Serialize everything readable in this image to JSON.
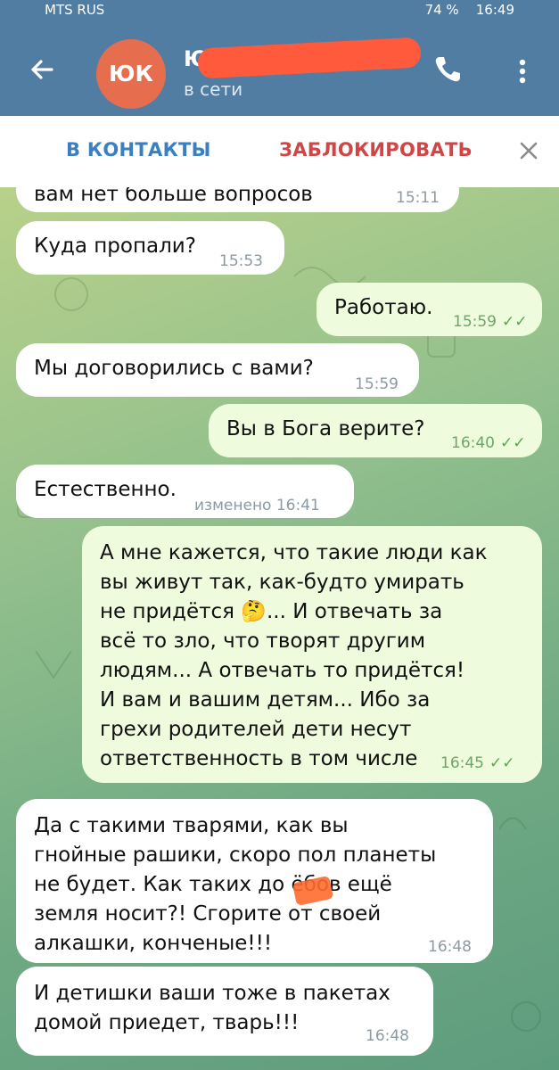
{
  "status_bar": {
    "carrier": "MTS RUS",
    "battery": "74 %",
    "clock": "16:49"
  },
  "header": {
    "avatar_initials": "ЮК",
    "contact_name": "Ю",
    "contact_status": "в сети",
    "colors": {
      "bar": "#517da2",
      "avatar": "#e66d4e"
    }
  },
  "actions": {
    "add_contact": "В КОНТАКТЫ",
    "block": "ЗАБЛОКИРОВАТЬ"
  },
  "messages": [
    {
      "dir": "in",
      "text": "вам нет больше вопросов",
      "time": "15:11"
    },
    {
      "dir": "in",
      "text": "Куда пропали?",
      "time": "15:53"
    },
    {
      "dir": "out",
      "text": "Работаю.",
      "time": "15:59"
    },
    {
      "dir": "in",
      "text": "Мы договорились с вами?",
      "time": "15:59"
    },
    {
      "dir": "out",
      "text": "Вы в Бога верите?",
      "time": "16:40"
    },
    {
      "dir": "in",
      "text": "Естественно.",
      "time": "изменено 16:41"
    },
    {
      "dir": "out",
      "text": "А мне кажется, что такие люди как\nвы живут так, как-будто умирать\nне придётся 🤔... И отвечать за\nвсё то зло, что творят другим\nлюдям... А отвечать то придётся!\nИ вам и вашим детям... Ибо за\nгрехи родителей дети несут\nответственность в том числе",
      "time": "16:45"
    },
    {
      "dir": "in",
      "text": "Да с такими тварями, как вы\nгнойные рашики, скоро пол планеты\nне будет. Как таких до    ёбов ещё\nземля носит?! Сгорите от своей\nалкашки, конченые!!!",
      "time": "16:48"
    },
    {
      "dir": "in",
      "text": "И детишки ваши тоже в пакетах\nдомой приедет, тварь!!!",
      "time": "16:48"
    }
  ]
}
